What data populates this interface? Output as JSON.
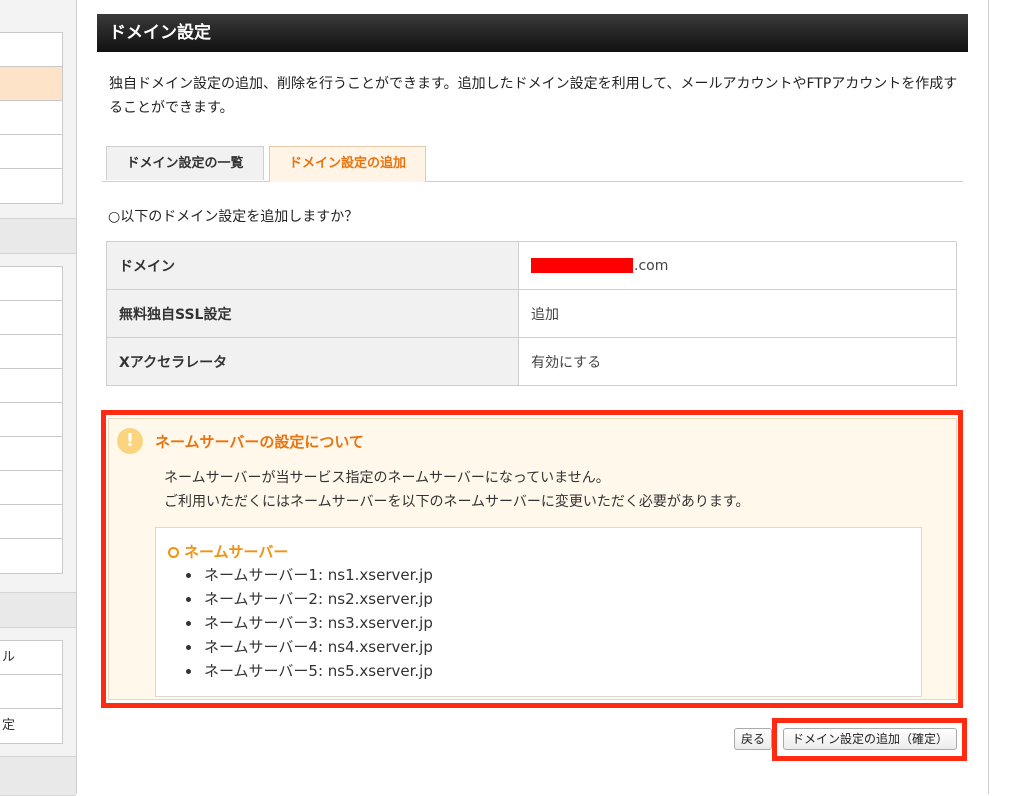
{
  "sidebar": {
    "groups": [
      {
        "rows": [
          "",
          "",
          "",
          "",
          ""
        ],
        "active_index": 1
      },
      {
        "rows": [
          "",
          "",
          "",
          "",
          "",
          "",
          "",
          "",
          ""
        ]
      },
      {
        "rows": [
          "ル",
          "",
          "定"
        ]
      }
    ]
  },
  "page": {
    "title": "ドメイン設定",
    "intro": "独自ドメイン設定の追加、削除を行うことができます。追加したドメイン設定を利用して、メールアカウントやFTPアカウントを作成することができます。"
  },
  "tabs": [
    {
      "label": "ドメイン設定の一覧",
      "active": false
    },
    {
      "label": "ドメイン設定の追加",
      "active": true
    }
  ],
  "question": "○以下のドメイン設定を追加しますか？",
  "confirm_table": {
    "rows": [
      {
        "label": "ドメイン",
        "value": ".com",
        "redacted": true
      },
      {
        "label": "無料独自SSL設定",
        "value": "追加"
      },
      {
        "label": "Xアクセラレータ",
        "value": "有効にする"
      }
    ]
  },
  "notice": {
    "icon": "!",
    "title": "ネームサーバーの設定について",
    "line1": "ネームサーバーが当サービス指定のネームサーバーになっていません。",
    "line2": "ご利用いただくにはネームサーバーを以下のネームサーバーに変更いただく必要があります。",
    "ns_title": "ネームサーバー",
    "ns_items": [
      "ネームサーバー1: ns1.xserver.jp",
      "ネームサーバー2: ns2.xserver.jp",
      "ネームサーバー3: ns3.xserver.jp",
      "ネームサーバー4: ns4.xserver.jp",
      "ネームサーバー5: ns5.xserver.jp"
    ]
  },
  "buttons": {
    "back": "戻る",
    "confirm": "ドメイン設定の追加（確定）"
  },
  "colors": {
    "highlight": "#ff2a12",
    "accent": "#e8730f"
  }
}
